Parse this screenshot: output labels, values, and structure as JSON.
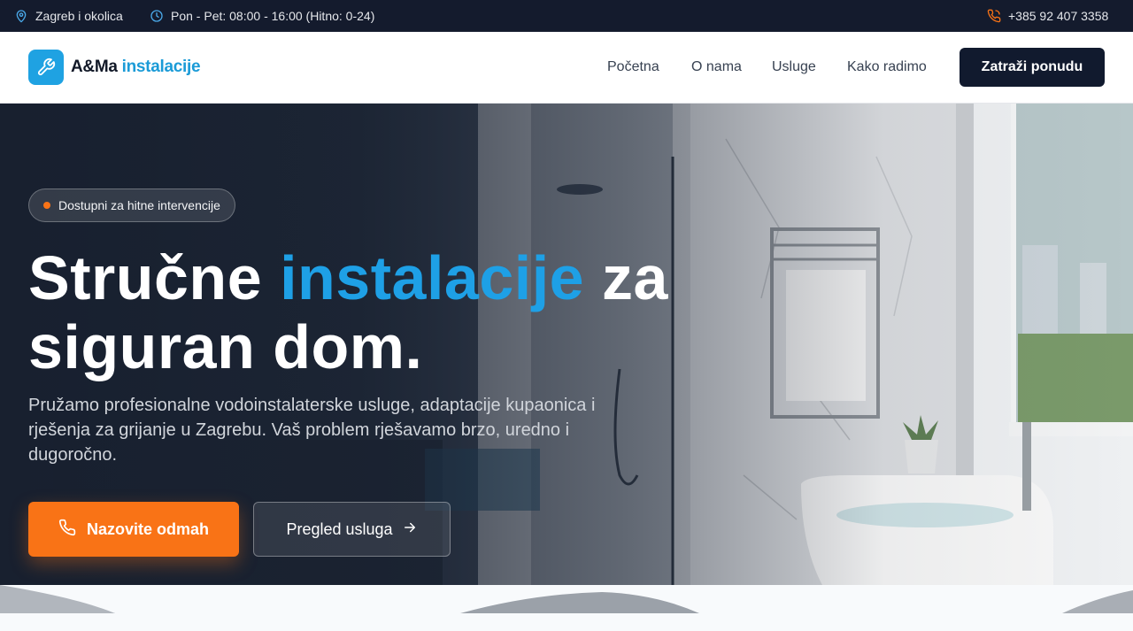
{
  "topbar": {
    "location": "Zagreb i okolica",
    "hours": "Pon - Pet: 08:00 - 16:00 (Hitno: 0-24)",
    "phone": "+385 92 407 3358",
    "icons": [
      "map-pin-icon",
      "clock-icon",
      "phone-icon"
    ]
  },
  "header": {
    "logo_primary": "A&Ma",
    "logo_secondary": "instalacije",
    "nav": [
      {
        "label": "Početna"
      },
      {
        "label": "O nama"
      },
      {
        "label": "Usluge"
      },
      {
        "label": "Kako radimo"
      }
    ],
    "cta_label": "Zatraži ponudu"
  },
  "hero": {
    "badge": "Dostupni za hitne intervencije",
    "headline_part1": "Stručne",
    "headline_accent": "instalacije",
    "headline_part2": "za",
    "headline_line2": "siguran dom.",
    "lead": "Pružamo profesionalne vodoinstalaterske usluge, adaptacije kupaonica i rješenja za grijanje u Zagrebu. Vaš problem rješavamo brzo, uredno i dugoročno.",
    "primary_button": "Nazovite odmah",
    "secondary_button": "Pregled usluga"
  },
  "colors": {
    "topbar_bg": "#141b2d",
    "accent_blue": "#1ea0e6",
    "accent_orange": "#f97316",
    "cta_dark": "#111a2e"
  }
}
